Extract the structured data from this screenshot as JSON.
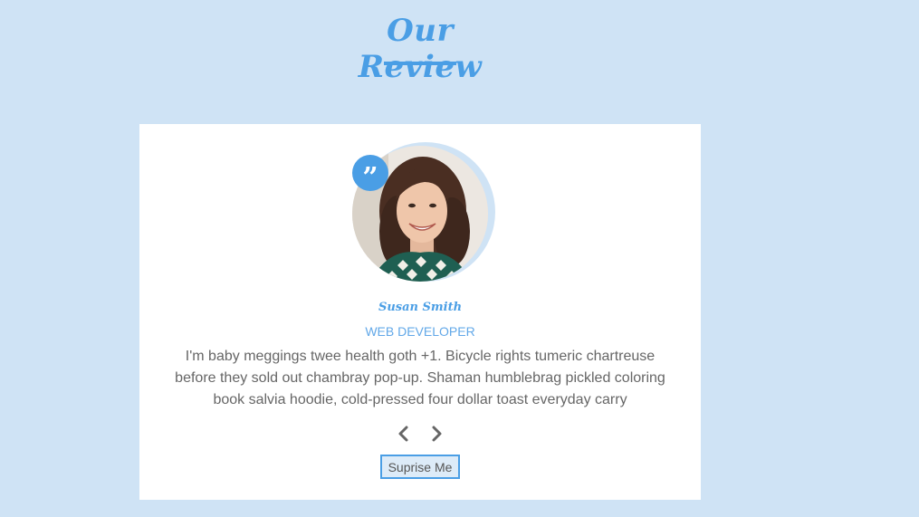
{
  "section": {
    "title": "Our Review"
  },
  "review": {
    "name": "Susan Smith",
    "job": "Web Developer",
    "text": "I'm baby meggings twee health goth +1. Bicycle rights tumeric chartreuse before they sold out chambray pop-up. Shaman humblebrag pickled coloring book salvia hoodie, cold-pressed four dollar toast everyday carry",
    "quote_glyph": "”"
  },
  "controls": {
    "prev_icon": "chevron-left-icon",
    "next_icon": "chevron-right-icon",
    "surprise_label": "Suprise Me"
  },
  "colors": {
    "background": "#cfe3f5",
    "accent": "#4a9ee5",
    "card": "#ffffff",
    "text": "#666666"
  }
}
